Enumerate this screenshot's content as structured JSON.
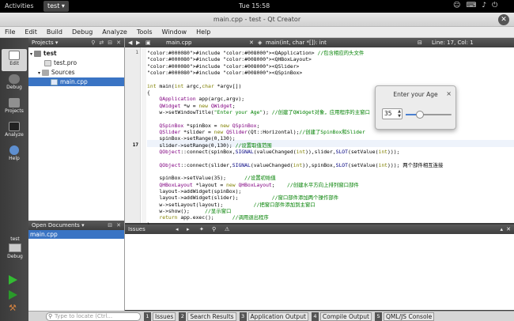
{
  "topbar": {
    "activities": "Activities",
    "app": "test",
    "clock": "Tue 15:58",
    "icons": [
      "accessibility-icon",
      "keyboard-icon",
      "volume-icon",
      "power-icon"
    ]
  },
  "window": {
    "title": "main.cpp - test - Qt Creator"
  },
  "menu": [
    "File",
    "Edit",
    "Build",
    "Debug",
    "Analyze",
    "Tools",
    "Window",
    "Help"
  ],
  "modes": [
    {
      "label": "Edit",
      "icon": "edit-icon",
      "active": true
    },
    {
      "label": "Debug",
      "icon": "debug-icon",
      "active": false
    },
    {
      "label": "Projects",
      "icon": "projects-icon",
      "active": false
    },
    {
      "label": "Analyze",
      "icon": "analyze-icon",
      "active": false
    },
    {
      "label": "Help",
      "icon": "help-icon",
      "active": false
    }
  ],
  "kit": {
    "project": "test",
    "config": "Debug"
  },
  "projects": {
    "header": "Projects",
    "tree": {
      "root": "test",
      "pro": "test.pro",
      "sources": "Sources",
      "main": "main.cpp"
    }
  },
  "opendocs": {
    "header": "Open Documents",
    "items": [
      "main.cpp"
    ]
  },
  "editor_toolbar": {
    "file": "main.cpp",
    "symbol": "main(int, char *[]): int",
    "position": "Line: 17, Col: 1"
  },
  "code": {
    "line_numbers": {
      "first": "1",
      "current": "17"
    },
    "lines": [
      "#include <QApplication> //包含相应的头文件",
      "#include <QHBoxLayout>",
      "#include <QSlider>",
      "#include <QSpinBox>",
      "",
      "int main(int argc,char *argv[])",
      "{",
      "    QApplication app(argc,argv);",
      "    QWidget *w = new QWidget;",
      "    w->setWindowTitle(\"Enter your Age\"); //创建了QWidget对象，应用程序的主窗口",
      "",
      "    QSpinBox *spinBox = new QSpinBox;",
      "    QSlider *slider = new QSlider(Qt::Horizontal);//创建了SpinBox和Slider",
      "    spinBox->setRange(0,130);",
      "    slider->setRange(0,130); //设置取值范围",
      "    QObject::connect(spinBox,SIGNAL(valueChanged(int)),slider,SLOT(setValue(int)));",
      "",
      "    QObject::connect(slider,SIGNAL(valueChanged(int)),spinBox,SLOT(setValue(int))); 两个部件相互连接",
      "",
      "    spinBox->setValue(35);      //设置初始值",
      "    QHBoxLayout *layout = new QHBoxLayout;    //创建水平方向上排列窗口部件",
      "    layout->addWidget(spinBox);",
      "    layout->addWidget(slider);           //窗口部件添加两个操作部件",
      "    w->setLayout(layout);          //把窗口部件添加到主窗口",
      "    w->show();     //显示窗口",
      "    return app.exec();      //调用退出程序",
      "}"
    ]
  },
  "dialog": {
    "title": "Enter your Age",
    "close": "×",
    "spin_value": "35",
    "slider_value": 35,
    "slider_max": 130
  },
  "issues": {
    "header": "Issues"
  },
  "bottom": {
    "locate_placeholder": "Type to locate (Ctrl...",
    "tabs": [
      {
        "num": "1",
        "label": "Issues"
      },
      {
        "num": "2",
        "label": "Search Results"
      },
      {
        "num": "3",
        "label": "Application Output"
      },
      {
        "num": "4",
        "label": "Compile Output"
      },
      {
        "num": "5",
        "label": "QML/JS Console"
      }
    ]
  },
  "colors": {
    "selection": "#3a74c4",
    "keyword": "#808000",
    "type": "#800080",
    "string": "#008000",
    "comment": "#008000",
    "macro": "#000080",
    "run": "#33bb33"
  }
}
